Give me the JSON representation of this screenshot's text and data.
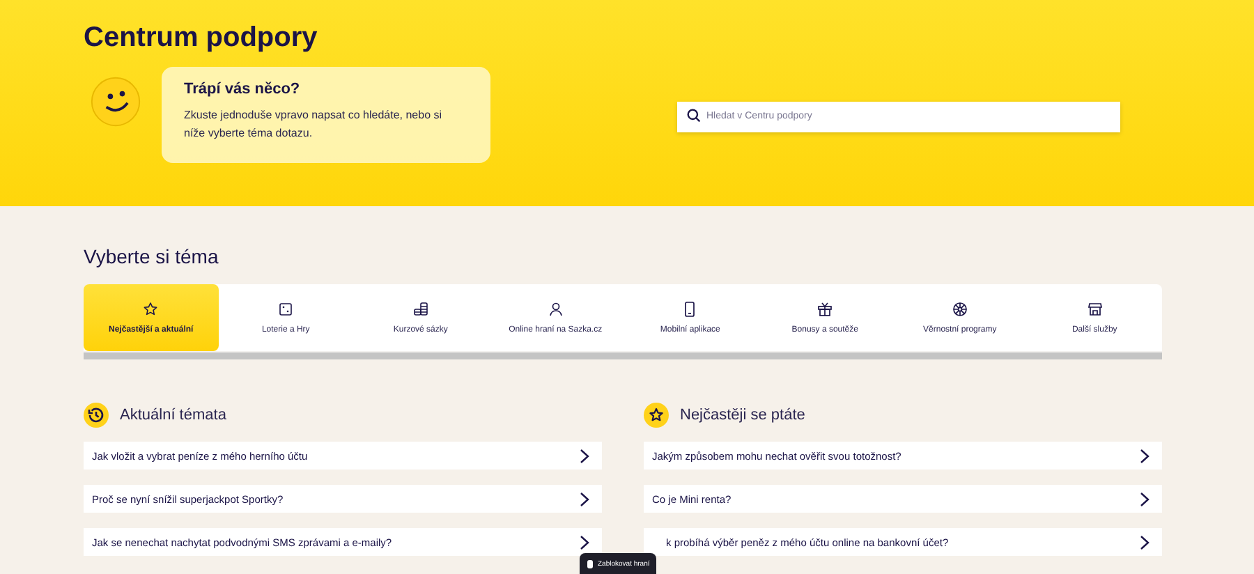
{
  "header": {
    "title": "Centrum podpory",
    "bubble": {
      "heading": "Trápí vás něco?",
      "text": "Zkuste jednoduše vpravo napsat co hledáte, nebo si níže vyberte téma dotazu."
    },
    "search": {
      "placeholder": "Hledat v Centru podpory"
    }
  },
  "topics": {
    "heading": "Vyberte si téma",
    "tabs": [
      {
        "label": "Nejčastější a aktuální",
        "selected": true
      },
      {
        "label": "Loterie a Hry",
        "selected": false
      },
      {
        "label": "Kurzové sázky",
        "selected": false
      },
      {
        "label": "Online hraní na Sazka.cz",
        "selected": false
      },
      {
        "label": "Mobilní aplikace",
        "selected": false
      },
      {
        "label": "Bonusy a soutěže",
        "selected": false
      },
      {
        "label": "Věrnostní programy",
        "selected": false
      },
      {
        "label": "Další služby",
        "selected": false
      }
    ]
  },
  "sections": [
    {
      "title": "Aktuální témata",
      "items": [
        "Jak vložit a vybrat peníze z mého herního účtu",
        "Proč se nyní snížil superjackpot Sportky?",
        "Jak se nenechat nachytat podvodnými SMS zprávami a e-maily?"
      ]
    },
    {
      "title": "Nejčastěji se ptáte",
      "items": [
        "Jakým způsobem mohu nechat ověřit svou totožnost?",
        "Co je Mini renta?",
        "k probíhá výběr peněz z mého účtu online na bankovní účet?"
      ]
    }
  ],
  "block_button": {
    "label": "Zablokovat hraní"
  }
}
